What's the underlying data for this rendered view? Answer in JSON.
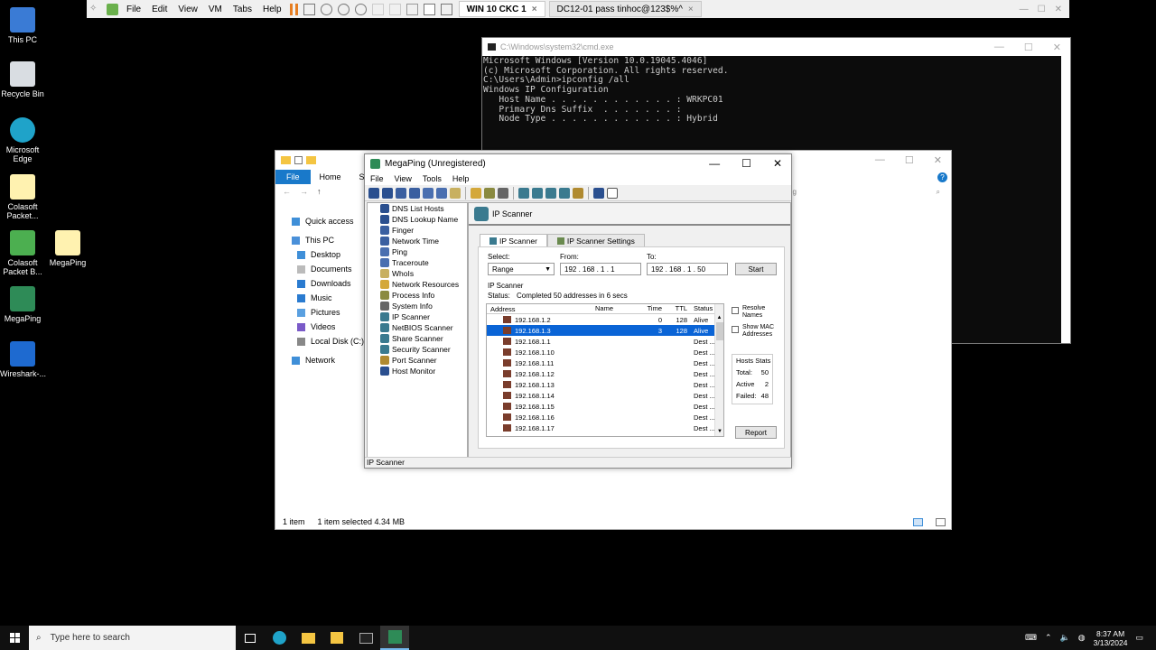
{
  "vmware": {
    "menus": [
      "File",
      "Edit",
      "View",
      "VM",
      "Tabs",
      "Help"
    ],
    "tabs": [
      "WIN 10 CKC 1",
      "DC12-01 pass tinhoc@123$%^"
    ]
  },
  "desktop_icons": [
    "This PC",
    "Recycle Bin",
    "Microsoft Edge",
    "Colasoft Packet...",
    "Colasoft Packet B...",
    "MegaPing",
    "MegaPing",
    "Wireshark-..."
  ],
  "cmd": {
    "title": "C:\\Windows\\system32\\cmd.exe",
    "lines": [
      "Microsoft Windows [Version 10.0.19045.4046]",
      "(c) Microsoft Corporation. All rights reserved.",
      "",
      "C:\\Users\\Admin>ipconfig /all",
      "",
      "Windows IP Configuration",
      "",
      "   Host Name . . . . . . . . . . . . : WRKPC01",
      "   Primary Dns Suffix  . . . . . . . :",
      "   Node Type . . . . . . . . . . . . : Hybrid"
    ]
  },
  "explorer": {
    "ribbon": [
      "File",
      "Home",
      "Sha"
    ],
    "nav": [
      "Quick access",
      "This PC",
      "Desktop",
      "Documents",
      "Downloads",
      "Music",
      "Pictures",
      "Videos",
      "Local Disk (C:)",
      "Network"
    ],
    "search_placeholder": "ng",
    "status_count": "1 item",
    "status_selected": "1 item selected  4.34 MB"
  },
  "megaping": {
    "title": "MegaPing (Unregistered)",
    "menu": [
      "File",
      "View",
      "Tools",
      "Help"
    ],
    "tree": [
      "DNS List Hosts",
      "DNS Lookup Name",
      "Finger",
      "Network Time",
      "Ping",
      "Traceroute",
      "WhoIs",
      "Network Resources",
      "Process Info",
      "System Info",
      "IP Scanner",
      "NetBIOS Scanner",
      "Share Scanner",
      "Security Scanner",
      "Port Scanner",
      "Host Monitor"
    ],
    "panel_title": "IP Scanner",
    "tab_active": "IP Scanner",
    "tab_settings": "IP Scanner Settings",
    "select_label": "Select:",
    "select_value": "Range",
    "from_label": "From:",
    "from_ip": "192 . 168 .  1  .  1",
    "to_label": "To:",
    "to_ip": "192 . 168 .  1  .  50",
    "start": "Start",
    "group_label": "IP Scanner",
    "status_label": "Status:",
    "status_value": "Completed 50 addresses in 6 secs",
    "columns": [
      "Address",
      "Name",
      "Time",
      "TTL",
      "Status"
    ],
    "rows": [
      {
        "addr": "192.168.1.2",
        "name": "",
        "time": "0",
        "ttl": "128",
        "status": "Alive"
      },
      {
        "addr": "192.168.1.3",
        "name": "",
        "time": "3",
        "ttl": "128",
        "status": "Alive"
      },
      {
        "addr": "192.168.1.1",
        "name": "",
        "time": "",
        "ttl": "",
        "status": "Dest ..."
      },
      {
        "addr": "192.168.1.10",
        "name": "",
        "time": "",
        "ttl": "",
        "status": "Dest ..."
      },
      {
        "addr": "192.168.1.11",
        "name": "",
        "time": "",
        "ttl": "",
        "status": "Dest ..."
      },
      {
        "addr": "192.168.1.12",
        "name": "",
        "time": "",
        "ttl": "",
        "status": "Dest ..."
      },
      {
        "addr": "192.168.1.13",
        "name": "",
        "time": "",
        "ttl": "",
        "status": "Dest ..."
      },
      {
        "addr": "192.168.1.14",
        "name": "",
        "time": "",
        "ttl": "",
        "status": "Dest ..."
      },
      {
        "addr": "192.168.1.15",
        "name": "",
        "time": "",
        "ttl": "",
        "status": "Dest ..."
      },
      {
        "addr": "192.168.1.16",
        "name": "",
        "time": "",
        "ttl": "",
        "status": "Dest ..."
      },
      {
        "addr": "192.168.1.17",
        "name": "",
        "time": "",
        "ttl": "",
        "status": "Dest ..."
      }
    ],
    "selected_row": 1,
    "resolve_names": "Resolve Names",
    "show_mac": "Show MAC Addresses",
    "hosts_stats": "Hosts Stats",
    "total_label": "Total:",
    "total": "50",
    "active_label": "Active",
    "active": "2",
    "failed_label": "Failed:",
    "failed": "48",
    "report": "Report",
    "statusbar": "IP Scanner"
  },
  "taskbar": {
    "search_placeholder": "Type here to search",
    "time": "8:37 AM",
    "date": "3/13/2024"
  },
  "colors": {
    "selection": "#0a64d6",
    "explorer_file_tab": "#1979ca",
    "taskbar": "#101010"
  }
}
